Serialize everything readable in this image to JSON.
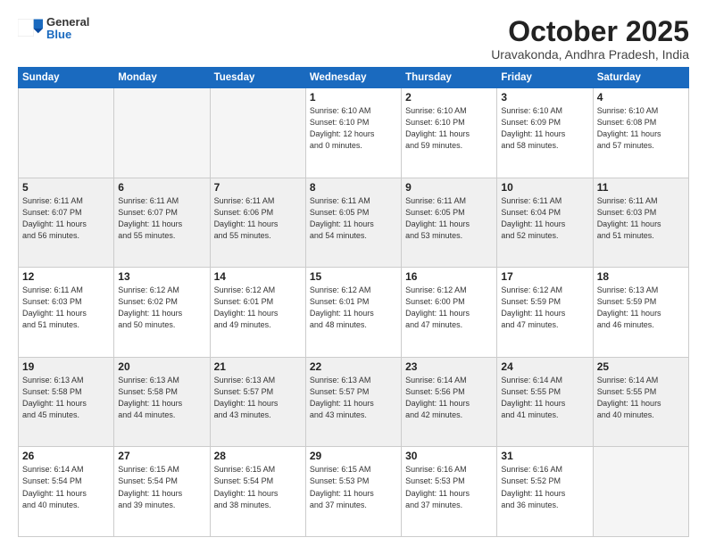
{
  "header": {
    "logo_general": "General",
    "logo_blue": "Blue",
    "title": "October 2025",
    "subtitle": "Uravakonda, Andhra Pradesh, India"
  },
  "weekdays": [
    "Sunday",
    "Monday",
    "Tuesday",
    "Wednesday",
    "Thursday",
    "Friday",
    "Saturday"
  ],
  "weeks": [
    [
      {
        "day": "",
        "info": ""
      },
      {
        "day": "",
        "info": ""
      },
      {
        "day": "",
        "info": ""
      },
      {
        "day": "1",
        "info": "Sunrise: 6:10 AM\nSunset: 6:10 PM\nDaylight: 12 hours\nand 0 minutes."
      },
      {
        "day": "2",
        "info": "Sunrise: 6:10 AM\nSunset: 6:10 PM\nDaylight: 11 hours\nand 59 minutes."
      },
      {
        "day": "3",
        "info": "Sunrise: 6:10 AM\nSunset: 6:09 PM\nDaylight: 11 hours\nand 58 minutes."
      },
      {
        "day": "4",
        "info": "Sunrise: 6:10 AM\nSunset: 6:08 PM\nDaylight: 11 hours\nand 57 minutes."
      }
    ],
    [
      {
        "day": "5",
        "info": "Sunrise: 6:11 AM\nSunset: 6:07 PM\nDaylight: 11 hours\nand 56 minutes."
      },
      {
        "day": "6",
        "info": "Sunrise: 6:11 AM\nSunset: 6:07 PM\nDaylight: 11 hours\nand 55 minutes."
      },
      {
        "day": "7",
        "info": "Sunrise: 6:11 AM\nSunset: 6:06 PM\nDaylight: 11 hours\nand 55 minutes."
      },
      {
        "day": "8",
        "info": "Sunrise: 6:11 AM\nSunset: 6:05 PM\nDaylight: 11 hours\nand 54 minutes."
      },
      {
        "day": "9",
        "info": "Sunrise: 6:11 AM\nSunset: 6:05 PM\nDaylight: 11 hours\nand 53 minutes."
      },
      {
        "day": "10",
        "info": "Sunrise: 6:11 AM\nSunset: 6:04 PM\nDaylight: 11 hours\nand 52 minutes."
      },
      {
        "day": "11",
        "info": "Sunrise: 6:11 AM\nSunset: 6:03 PM\nDaylight: 11 hours\nand 51 minutes."
      }
    ],
    [
      {
        "day": "12",
        "info": "Sunrise: 6:11 AM\nSunset: 6:03 PM\nDaylight: 11 hours\nand 51 minutes."
      },
      {
        "day": "13",
        "info": "Sunrise: 6:12 AM\nSunset: 6:02 PM\nDaylight: 11 hours\nand 50 minutes."
      },
      {
        "day": "14",
        "info": "Sunrise: 6:12 AM\nSunset: 6:01 PM\nDaylight: 11 hours\nand 49 minutes."
      },
      {
        "day": "15",
        "info": "Sunrise: 6:12 AM\nSunset: 6:01 PM\nDaylight: 11 hours\nand 48 minutes."
      },
      {
        "day": "16",
        "info": "Sunrise: 6:12 AM\nSunset: 6:00 PM\nDaylight: 11 hours\nand 47 minutes."
      },
      {
        "day": "17",
        "info": "Sunrise: 6:12 AM\nSunset: 5:59 PM\nDaylight: 11 hours\nand 47 minutes."
      },
      {
        "day": "18",
        "info": "Sunrise: 6:13 AM\nSunset: 5:59 PM\nDaylight: 11 hours\nand 46 minutes."
      }
    ],
    [
      {
        "day": "19",
        "info": "Sunrise: 6:13 AM\nSunset: 5:58 PM\nDaylight: 11 hours\nand 45 minutes."
      },
      {
        "day": "20",
        "info": "Sunrise: 6:13 AM\nSunset: 5:58 PM\nDaylight: 11 hours\nand 44 minutes."
      },
      {
        "day": "21",
        "info": "Sunrise: 6:13 AM\nSunset: 5:57 PM\nDaylight: 11 hours\nand 43 minutes."
      },
      {
        "day": "22",
        "info": "Sunrise: 6:13 AM\nSunset: 5:57 PM\nDaylight: 11 hours\nand 43 minutes."
      },
      {
        "day": "23",
        "info": "Sunrise: 6:14 AM\nSunset: 5:56 PM\nDaylight: 11 hours\nand 42 minutes."
      },
      {
        "day": "24",
        "info": "Sunrise: 6:14 AM\nSunset: 5:55 PM\nDaylight: 11 hours\nand 41 minutes."
      },
      {
        "day": "25",
        "info": "Sunrise: 6:14 AM\nSunset: 5:55 PM\nDaylight: 11 hours\nand 40 minutes."
      }
    ],
    [
      {
        "day": "26",
        "info": "Sunrise: 6:14 AM\nSunset: 5:54 PM\nDaylight: 11 hours\nand 40 minutes."
      },
      {
        "day": "27",
        "info": "Sunrise: 6:15 AM\nSunset: 5:54 PM\nDaylight: 11 hours\nand 39 minutes."
      },
      {
        "day": "28",
        "info": "Sunrise: 6:15 AM\nSunset: 5:54 PM\nDaylight: 11 hours\nand 38 minutes."
      },
      {
        "day": "29",
        "info": "Sunrise: 6:15 AM\nSunset: 5:53 PM\nDaylight: 11 hours\nand 37 minutes."
      },
      {
        "day": "30",
        "info": "Sunrise: 6:16 AM\nSunset: 5:53 PM\nDaylight: 11 hours\nand 37 minutes."
      },
      {
        "day": "31",
        "info": "Sunrise: 6:16 AM\nSunset: 5:52 PM\nDaylight: 11 hours\nand 36 minutes."
      },
      {
        "day": "",
        "info": ""
      }
    ]
  ]
}
